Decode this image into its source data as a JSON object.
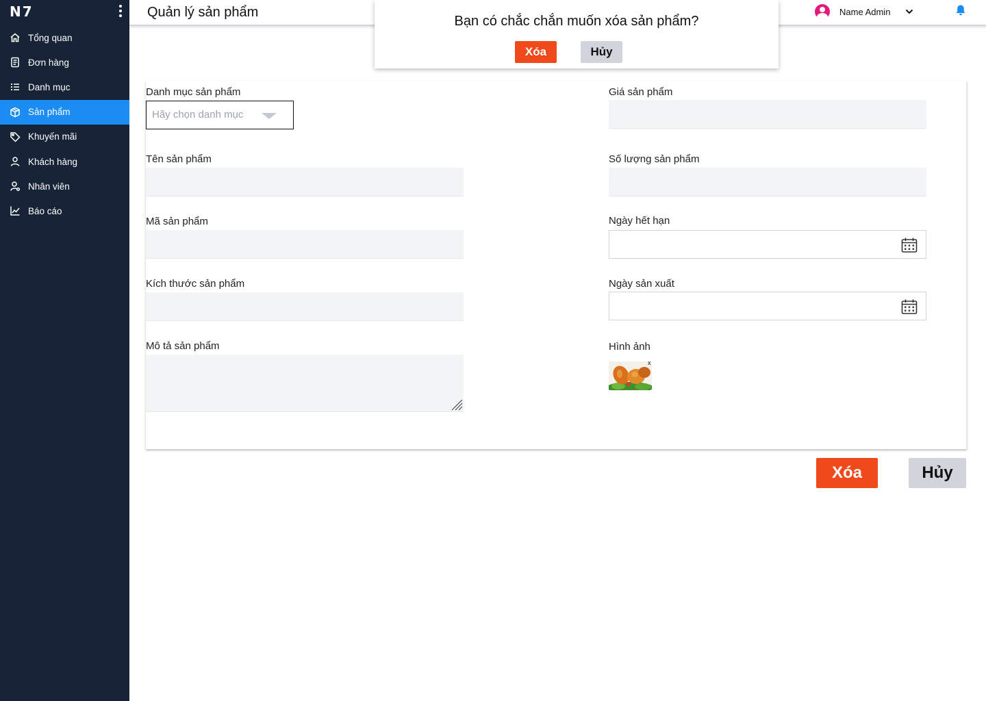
{
  "sidebar": {
    "brand": "N7",
    "items": [
      {
        "label": "Tổng quan",
        "icon": "home-icon"
      },
      {
        "label": "Đơn hàng",
        "icon": "receipt-icon"
      },
      {
        "label": "Danh mục",
        "icon": "list-icon"
      },
      {
        "label": "Sản phẩm",
        "icon": "box-icon",
        "active": true
      },
      {
        "label": "Khuyến mãi",
        "icon": "tag-icon"
      },
      {
        "label": "Khách hàng",
        "icon": "user-icon"
      },
      {
        "label": "Nhân viên",
        "icon": "staff-icon"
      },
      {
        "label": "Báo cáo",
        "icon": "chart-icon"
      }
    ],
    "active_color": "#1a8cf2",
    "background": "#172336"
  },
  "header": {
    "title": "Quản lý sản phẩm",
    "user_name": "Name Admin",
    "avatar_color": "#e6187a",
    "bell_color": "#1a8cf2"
  },
  "dialog": {
    "message": "Bạn có chắc chắn muốn xóa sản phẩm?",
    "delete_label": "Xóa",
    "cancel_label": "Hủy"
  },
  "form": {
    "category": {
      "label": "Danh mục sản phẩm",
      "placeholder": "Hãy chọn danh mục",
      "value": ""
    },
    "name": {
      "label": "Tên sản phẩm",
      "value": ""
    },
    "code": {
      "label": "Mã sản phẩm",
      "value": ""
    },
    "size": {
      "label": "Kích thước sản phẩm",
      "value": ""
    },
    "description": {
      "label": "Mô tả sản phẩm",
      "value": ""
    },
    "price": {
      "label": "Giá sản phẩm",
      "value": ""
    },
    "quantity": {
      "label": "Số lượng sản phẩm",
      "value": ""
    },
    "expiry_date": {
      "label": "Ngày hết hạn",
      "value": ""
    },
    "manufacture_date": {
      "label": "Ngày sản xuất",
      "value": ""
    },
    "image": {
      "label": "Hình ảnh",
      "remove_symbol": "x"
    }
  },
  "actions": {
    "delete_label": "Xóa",
    "cancel_label": "Hủy",
    "delete_color": "#f04a1c",
    "cancel_color": "#d1d5db"
  }
}
